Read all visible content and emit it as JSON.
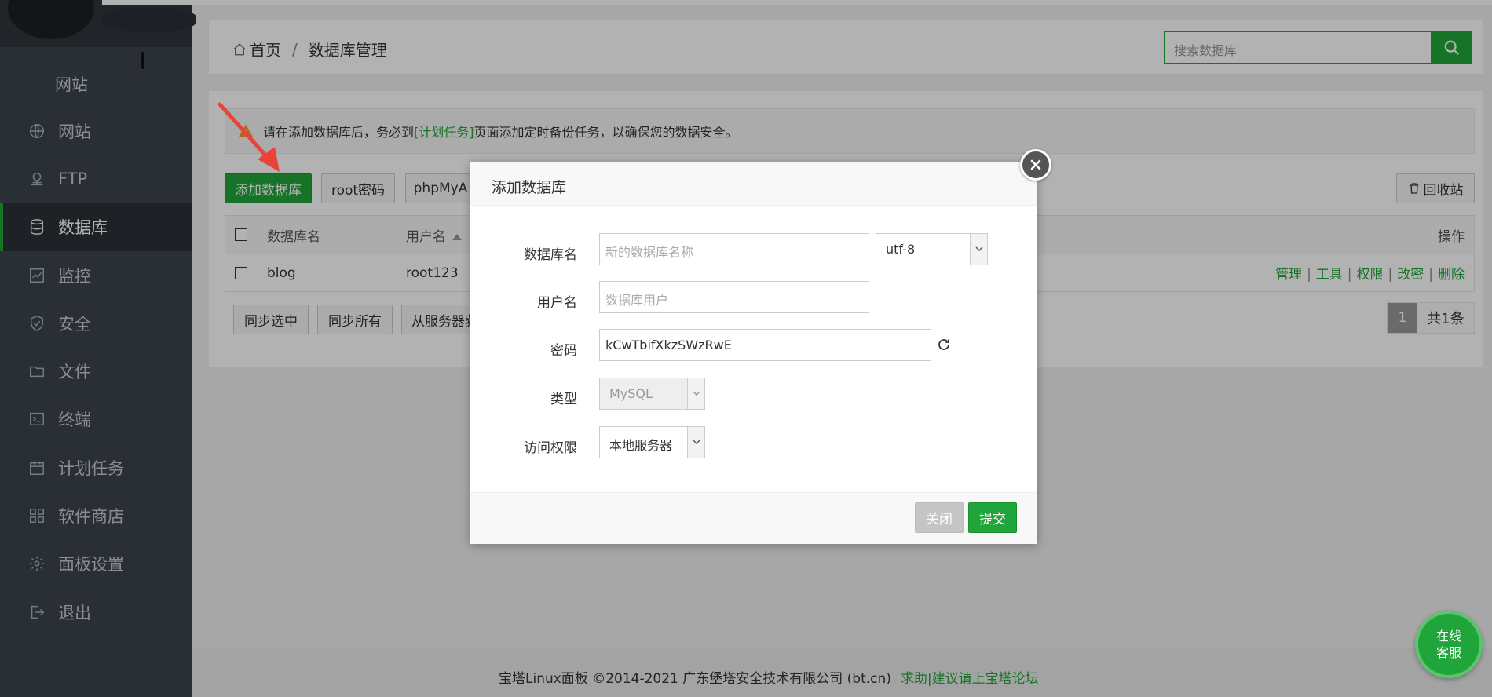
{
  "sidebar": {
    "top_label": "网站",
    "items": [
      {
        "label": "网站",
        "icon": "globe-icon"
      },
      {
        "label": "FTP",
        "icon": "ftp-icon"
      },
      {
        "label": "数据库",
        "icon": "database-icon",
        "active": true
      },
      {
        "label": "监控",
        "icon": "monitor-icon"
      },
      {
        "label": "安全",
        "icon": "shield-icon"
      },
      {
        "label": "文件",
        "icon": "folder-icon"
      },
      {
        "label": "终端",
        "icon": "terminal-icon"
      },
      {
        "label": "计划任务",
        "icon": "calendar-icon"
      },
      {
        "label": "软件商店",
        "icon": "grid-icon"
      },
      {
        "label": "面板设置",
        "icon": "gear-icon"
      },
      {
        "label": "退出",
        "icon": "logout-icon"
      }
    ]
  },
  "breadcrumb": {
    "home": "首页",
    "sep": "/",
    "current": "数据库管理"
  },
  "search": {
    "placeholder": "搜索数据库"
  },
  "notice": {
    "before": "请在添加数据库后，务必到",
    "link": "[计划任务]",
    "after": "页面添加定时备份任务，以确保您的数据安全。"
  },
  "toolbar": {
    "add_db": "添加数据库",
    "root_pwd": "root密码",
    "phpmyadmin": "phpMyA",
    "recycle": "回收站"
  },
  "table": {
    "headers": {
      "name": "数据库名",
      "user": "用户名",
      "ops": "操作"
    },
    "rows": [
      {
        "name": "blog",
        "user": "root123",
        "ops": [
          "管理",
          "工具",
          "权限",
          "改密",
          "删除"
        ]
      }
    ]
  },
  "bottom_buttons": {
    "sync_selected": "同步选中",
    "sync_all": "同步所有",
    "from_server": "从服务器获"
  },
  "pager": {
    "current": "1",
    "total": "共1条"
  },
  "footer": {
    "copyright": "宝塔Linux面板 ©2014-2021 广东堡塔安全技术有限公司 (bt.cn)",
    "help": "求助|建议请上宝塔论坛"
  },
  "modal": {
    "title": "添加数据库",
    "fields": {
      "db_name_label": "数据库名",
      "db_name_placeholder": "新的数据库名称",
      "charset": "utf-8",
      "user_label": "用户名",
      "user_placeholder": "数据库用户",
      "password_label": "密码",
      "password_value": "kCwTbifXkzSWzRwE",
      "type_label": "类型",
      "type_value": "MySQL",
      "access_label": "访问权限",
      "access_value": "本地服务器"
    },
    "close_btn": "关闭",
    "submit_btn": "提交"
  },
  "service": {
    "line1": "在线",
    "line2": "客服"
  },
  "colors": {
    "brand": "#20a53a",
    "sidebar": "#3c444d",
    "arrow": "#e8423a"
  }
}
